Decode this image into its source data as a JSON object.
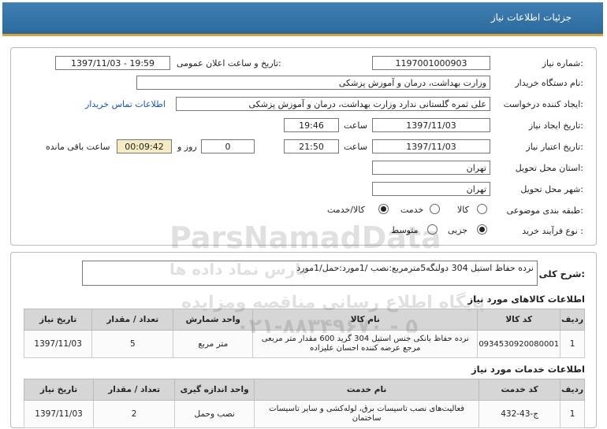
{
  "header": {
    "title": "جزئیات اطلاعات نیاز"
  },
  "form": {
    "need_no_label": "شماره نیاز:",
    "need_no": "1197001000903",
    "announce_label": "تاریخ و ساعت اعلان عمومی:",
    "announce_value": "1397/11/03 - 19:59",
    "buyer_label": "نام دستگاه خریدار:",
    "buyer_value": "وزارت بهداشت، درمان و آموزش پزشکی",
    "creator_label": "ایجاد کننده درخواست:",
    "creator_value": "علی ثمره گلستانی ندارد وزارت بهداشت، درمان و آموزش پزشکی",
    "contact_link": "اطلاعات تماس خریدار",
    "create_date_label": "تاریخ ایجاد نیاز:",
    "create_date": "1397/11/03",
    "time_label": "ساعت",
    "create_time": "19:46",
    "validity_label": "تاریخ اعتبار نیاز:",
    "validity_date": "1397/11/03",
    "validity_time": "21:50",
    "days_value": "0",
    "days_label": "روز و",
    "remaining_time": "00:09:42",
    "remaining_label": "ساعت باقی مانده",
    "province_label": "استان محل تحویل:",
    "province": "تهران",
    "city_label": "شهر محل تحویل:",
    "city": "تهران",
    "category_label": "طبقه بندی موضوعی:",
    "category_options": [
      "کالا",
      "خدمت",
      "کالا/خدمت"
    ],
    "purchase_label": "نوع فرآیند خرید :",
    "purchase_options": [
      "جزیی",
      "متوسط"
    ]
  },
  "description": {
    "label": "شرح کلی نیاز:",
    "value": "نرده حفاظ استیل 304 دولنگه5مترمربع:نصب /1مورد:حمل/1مورد"
  },
  "goods": {
    "title": "اطلاعات کالاهای مورد نیاز",
    "headers": [
      "ردیف",
      "کد کالا",
      "نام کالا",
      "واحد شمارش",
      "تعداد / مقدار",
      "تاریخ نیاز"
    ],
    "rows": [
      [
        "1",
        "0934530920080001",
        "نرده حفاظ بانکی جنس استیل 304 گرید 600 مقدار متر مربعی مرجع عرضه کننده احسان علیزاده",
        "متر مربع",
        "5",
        "1397/11/03"
      ]
    ]
  },
  "services": {
    "title": "اطلاعات خدمات مورد نیاز",
    "headers": [
      "ردیف",
      "کد خدمت",
      "نام خدمت",
      "واحد اندازه گیری",
      "تعداد / مقدار",
      "تاریخ نیاز"
    ],
    "rows": [
      [
        "1",
        "ج-43-432",
        "فعالیت‌های نصب تاسیسات برق، لوله‌کشی و سایر تاسیسات ساختمان",
        "نصب وحمل",
        "2",
        "1397/11/03"
      ]
    ]
  },
  "watermark": {
    "latin": "ParsNamadData",
    "persian_1": "پارس نماد داده ها",
    "persian_2": "پایگاه اطلاع رسانی مناقصه ومزایده",
    "phone": "۰۲۱-۸۸۳۴۹۶۷۰ - ۵"
  }
}
